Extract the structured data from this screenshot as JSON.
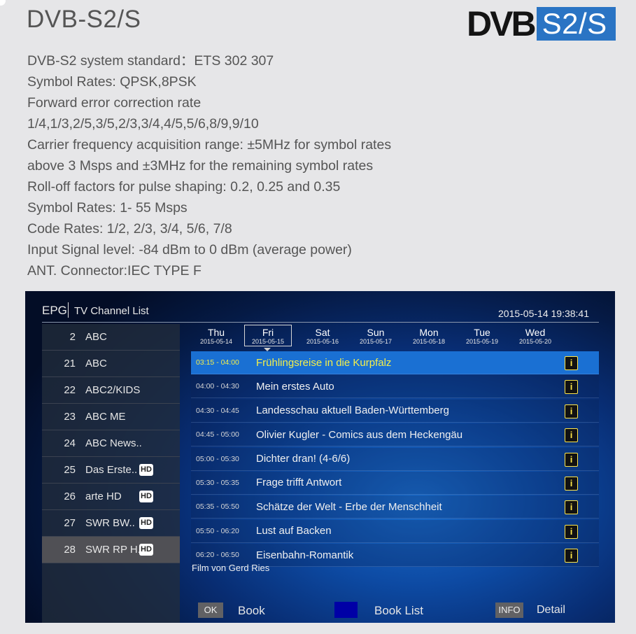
{
  "page": {
    "title": "DVB-S2/S",
    "logo": {
      "dvb": "DVB",
      "suffix": "S2/S"
    },
    "specs": [
      "DVB-S2 system standard：ETS 302 307",
      "Symbol Rates: QPSK,8PSK",
      "Forward error correction rate",
      "1/4,1/3,2/5,3/5,2/3,3/4,4/5,5/6,8/9,9/10",
      "Carrier frequency acquisition range: ±5MHz for symbol rates",
      "above 3 Msps and ±3MHz for the remaining symbol rates",
      "Roll-off factors for pulse shaping: 0.2, 0.25 and 0.35",
      "Symbol Rates: 1- 55 Msps",
      "Code Rates: 1/2, 2/3, 3/4, 5/6, 7/8",
      "Input Signal level: -84 dBm to  0 dBm (average power)",
      "ANT. Connector:IEC TYPE F"
    ]
  },
  "epg": {
    "header": {
      "epg": "EPG",
      "list": "TV Channel List",
      "datetime": "2015-05-14 19:38:41"
    },
    "channels": [
      {
        "num": "2",
        "name": "ABC",
        "hd": false
      },
      {
        "num": "21",
        "name": "ABC",
        "hd": false
      },
      {
        "num": "22",
        "name": "ABC2/KIDS",
        "hd": false
      },
      {
        "num": "23",
        "name": "ABC ME",
        "hd": false
      },
      {
        "num": "24",
        "name": "ABC News..",
        "hd": false
      },
      {
        "num": "25",
        "name": "Das Erste..",
        "hd": true
      },
      {
        "num": "26",
        "name": "arte HD",
        "hd": true
      },
      {
        "num": "27",
        "name": "SWR BW..",
        "hd": true
      },
      {
        "num": "28",
        "name": "SWR RP H..",
        "hd": true,
        "selected": true
      }
    ],
    "hd_label": "HD",
    "days": [
      {
        "day": "Thu",
        "date": "2015-05-14"
      },
      {
        "day": "Fri",
        "date": "2015-05-15",
        "selected": true
      },
      {
        "day": "Sat",
        "date": "2015-05-16"
      },
      {
        "day": "Sun",
        "date": "2015-05-17"
      },
      {
        "day": "Mon",
        "date": "2015-05-18"
      },
      {
        "day": "Tue",
        "date": "2015-05-19"
      },
      {
        "day": "Wed",
        "date": "2015-05-20"
      }
    ],
    "programs": [
      {
        "time": "03:15 - 04:00",
        "title": "Frühlingsreise in die Kurpfalz",
        "selected": true
      },
      {
        "time": "04:00 - 04:30",
        "title": "Mein erstes Auto"
      },
      {
        "time": "04:30 - 04:45",
        "title": "Landesschau aktuell Baden-Württemberg"
      },
      {
        "time": "04:45 - 05:00",
        "title": "Olivier Kugler - Comics aus dem Heckengäu"
      },
      {
        "time": "05:00 - 05:30",
        "title": "Dichter dran! (4-6/6)"
      },
      {
        "time": "05:30 - 05:35",
        "title": "Frage trifft Antwort"
      },
      {
        "time": "05:35 - 05:50",
        "title": "Schätze der Welt - Erbe der Menschheit"
      },
      {
        "time": "05:50 - 06:20",
        "title": "Lust auf Backen"
      },
      {
        "time": "06:20 - 06:50",
        "title": "Eisenbahn-Romantik"
      }
    ],
    "info_glyph": "i",
    "description": "Film von Gerd Ries",
    "footer": {
      "ok": "OK",
      "book": "Book",
      "book_list": "Book List",
      "info": "INFO",
      "detail": "Detail"
    },
    "colors": {
      "selected_row": "#1a70d3",
      "selected_text": "#f4ef4a",
      "book_list_key": "#0000a6",
      "logo_blue": "#2a74c4"
    }
  }
}
